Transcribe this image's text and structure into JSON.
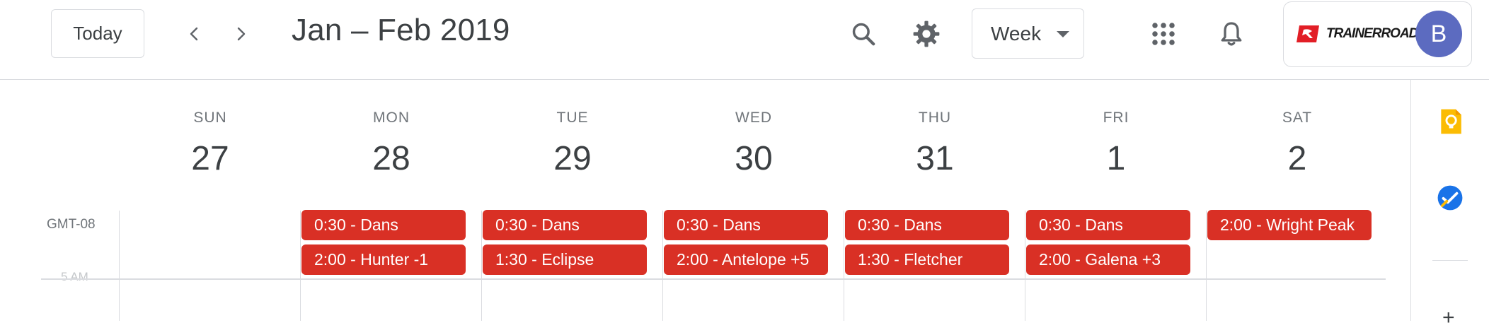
{
  "header": {
    "today_label": "Today",
    "title": "Jan – Feb 2019",
    "view_label": "Week",
    "brand": "TRAINERROAD",
    "avatar_initial": "B"
  },
  "timezone_label": "GMT-08",
  "hour_label": "5 AM",
  "days": [
    {
      "dow": "SUN",
      "date": "27"
    },
    {
      "dow": "MON",
      "date": "28"
    },
    {
      "dow": "TUE",
      "date": "29"
    },
    {
      "dow": "WED",
      "date": "30"
    },
    {
      "dow": "THU",
      "date": "31"
    },
    {
      "dow": "FRI",
      "date": "1"
    },
    {
      "dow": "SAT",
      "date": "2"
    }
  ],
  "events": {
    "mon": [
      "0:30 - Dans",
      "2:00 - Hunter -1"
    ],
    "tue": [
      "0:30 - Dans",
      "1:30 - Eclipse"
    ],
    "wed": [
      "0:30 - Dans",
      "2:00 - Antelope +5"
    ],
    "thu": [
      "0:30 - Dans",
      "1:30 - Fletcher"
    ],
    "fri": [
      "0:30 - Dans",
      "2:00 - Galena +3"
    ],
    "sat": [
      "2:00 - Wright Peak"
    ]
  },
  "colors": {
    "event": "#d93025",
    "avatar": "#5c6bc0",
    "keep": "#fbbc04",
    "tasks": "#1a73e8",
    "brand": "#e21e26"
  },
  "icons": [
    "chevron-left-icon",
    "chevron-right-icon",
    "search-icon",
    "gear-icon",
    "apps-grid-icon",
    "bell-icon",
    "keep-bulb-icon",
    "tasks-check-icon",
    "plus-icon"
  ]
}
